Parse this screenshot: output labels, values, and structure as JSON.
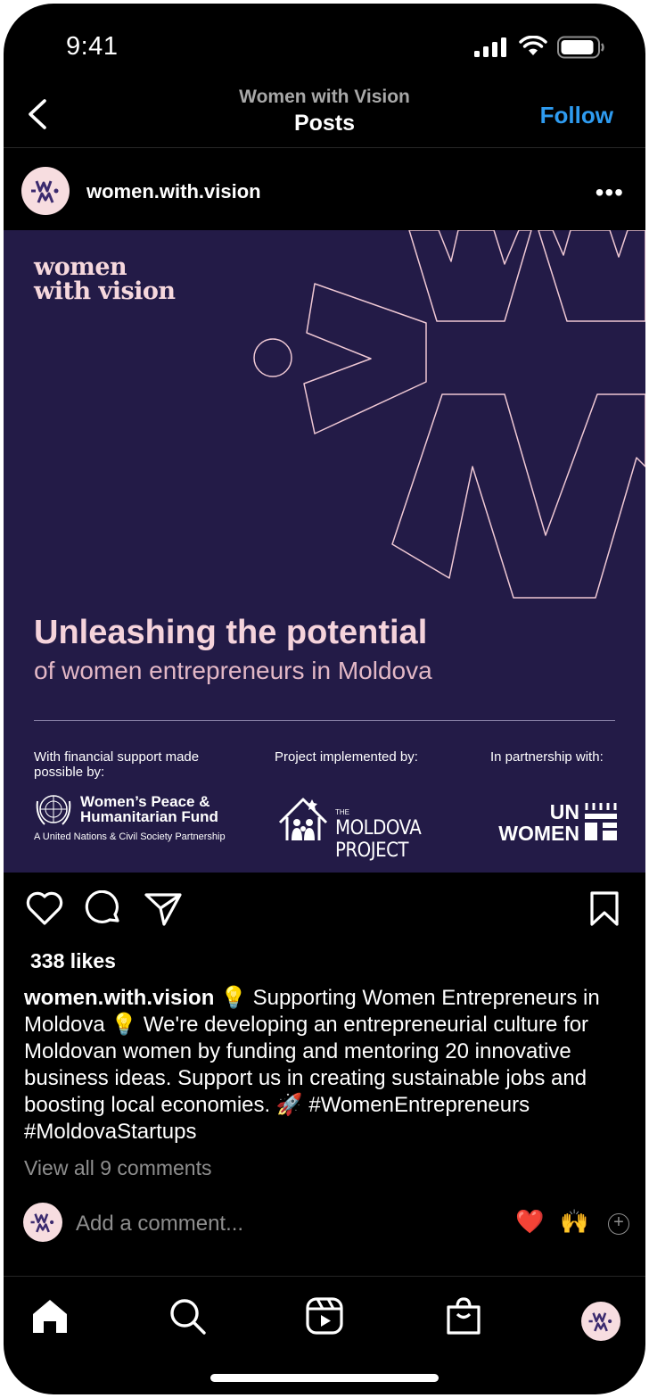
{
  "status_bar": {
    "time": "9:41"
  },
  "header": {
    "subtitle": "Women with Vision",
    "title": "Posts",
    "follow_label": "Follow"
  },
  "post": {
    "username": "women.with.vision",
    "more_label": "•••",
    "image": {
      "logo_line1": "women",
      "logo_line2": "with vision",
      "headline": "Unleashing the potential",
      "subheadline": "of women entrepreneurs in Moldova",
      "credits": [
        {
          "label": "With financial support made possible by:"
        },
        {
          "label": "Project implemented by:"
        },
        {
          "label": "In partnership with:"
        }
      ],
      "fund_name_line1": "Women’s Peace &",
      "fund_name_line2": "Humanitarian Fund",
      "fund_tagline": "A United Nations & Civil Society Partnership",
      "moldova_the": "THE",
      "moldova_name": "MOLDOVA PROJECT",
      "un_line1": "UN",
      "un_line2": "WOMEN"
    },
    "likes": "338 likes",
    "caption_user": "women.with.vision",
    "caption_text": "💡 Supporting Women Entrepreneurs in Moldova 💡 We're developing an entrepreneurial culture for Moldovan women by funding and mentoring 20 innovative business ideas. Support us in creating sustainable jobs and boosting local economies. 🚀 #WomenEntrepreneurs #MoldovaStartups",
    "view_comments": "View all 9 comments",
    "comment_placeholder": "Add a comment...",
    "quick_reactions": [
      "❤️",
      "🙌"
    ],
    "plus_label": "+"
  },
  "colors": {
    "accent": "#2e9bf0",
    "image_bg": "#231b47",
    "logo_pink": "#f6d8dd",
    "avatar_bg": "#f7dde0",
    "avatar_mark": "#3b2a6e"
  },
  "tabbar": [
    "home-icon",
    "search-icon",
    "reels-icon",
    "shop-icon",
    "profile-avatar"
  ]
}
